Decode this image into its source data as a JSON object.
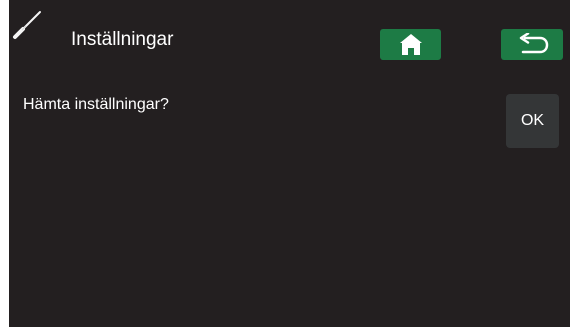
{
  "header": {
    "title": "Inställningar",
    "settings_icon": "screwdriver-icon",
    "home_icon": "home-icon",
    "back_icon": "back-arrow-icon"
  },
  "dialog": {
    "message": "Hämta inställningar?",
    "ok_label": "OK"
  },
  "colors": {
    "background": "#231f20",
    "text": "#ffffff",
    "nav_button": "#1d7b45",
    "ok_button": "#343637"
  }
}
